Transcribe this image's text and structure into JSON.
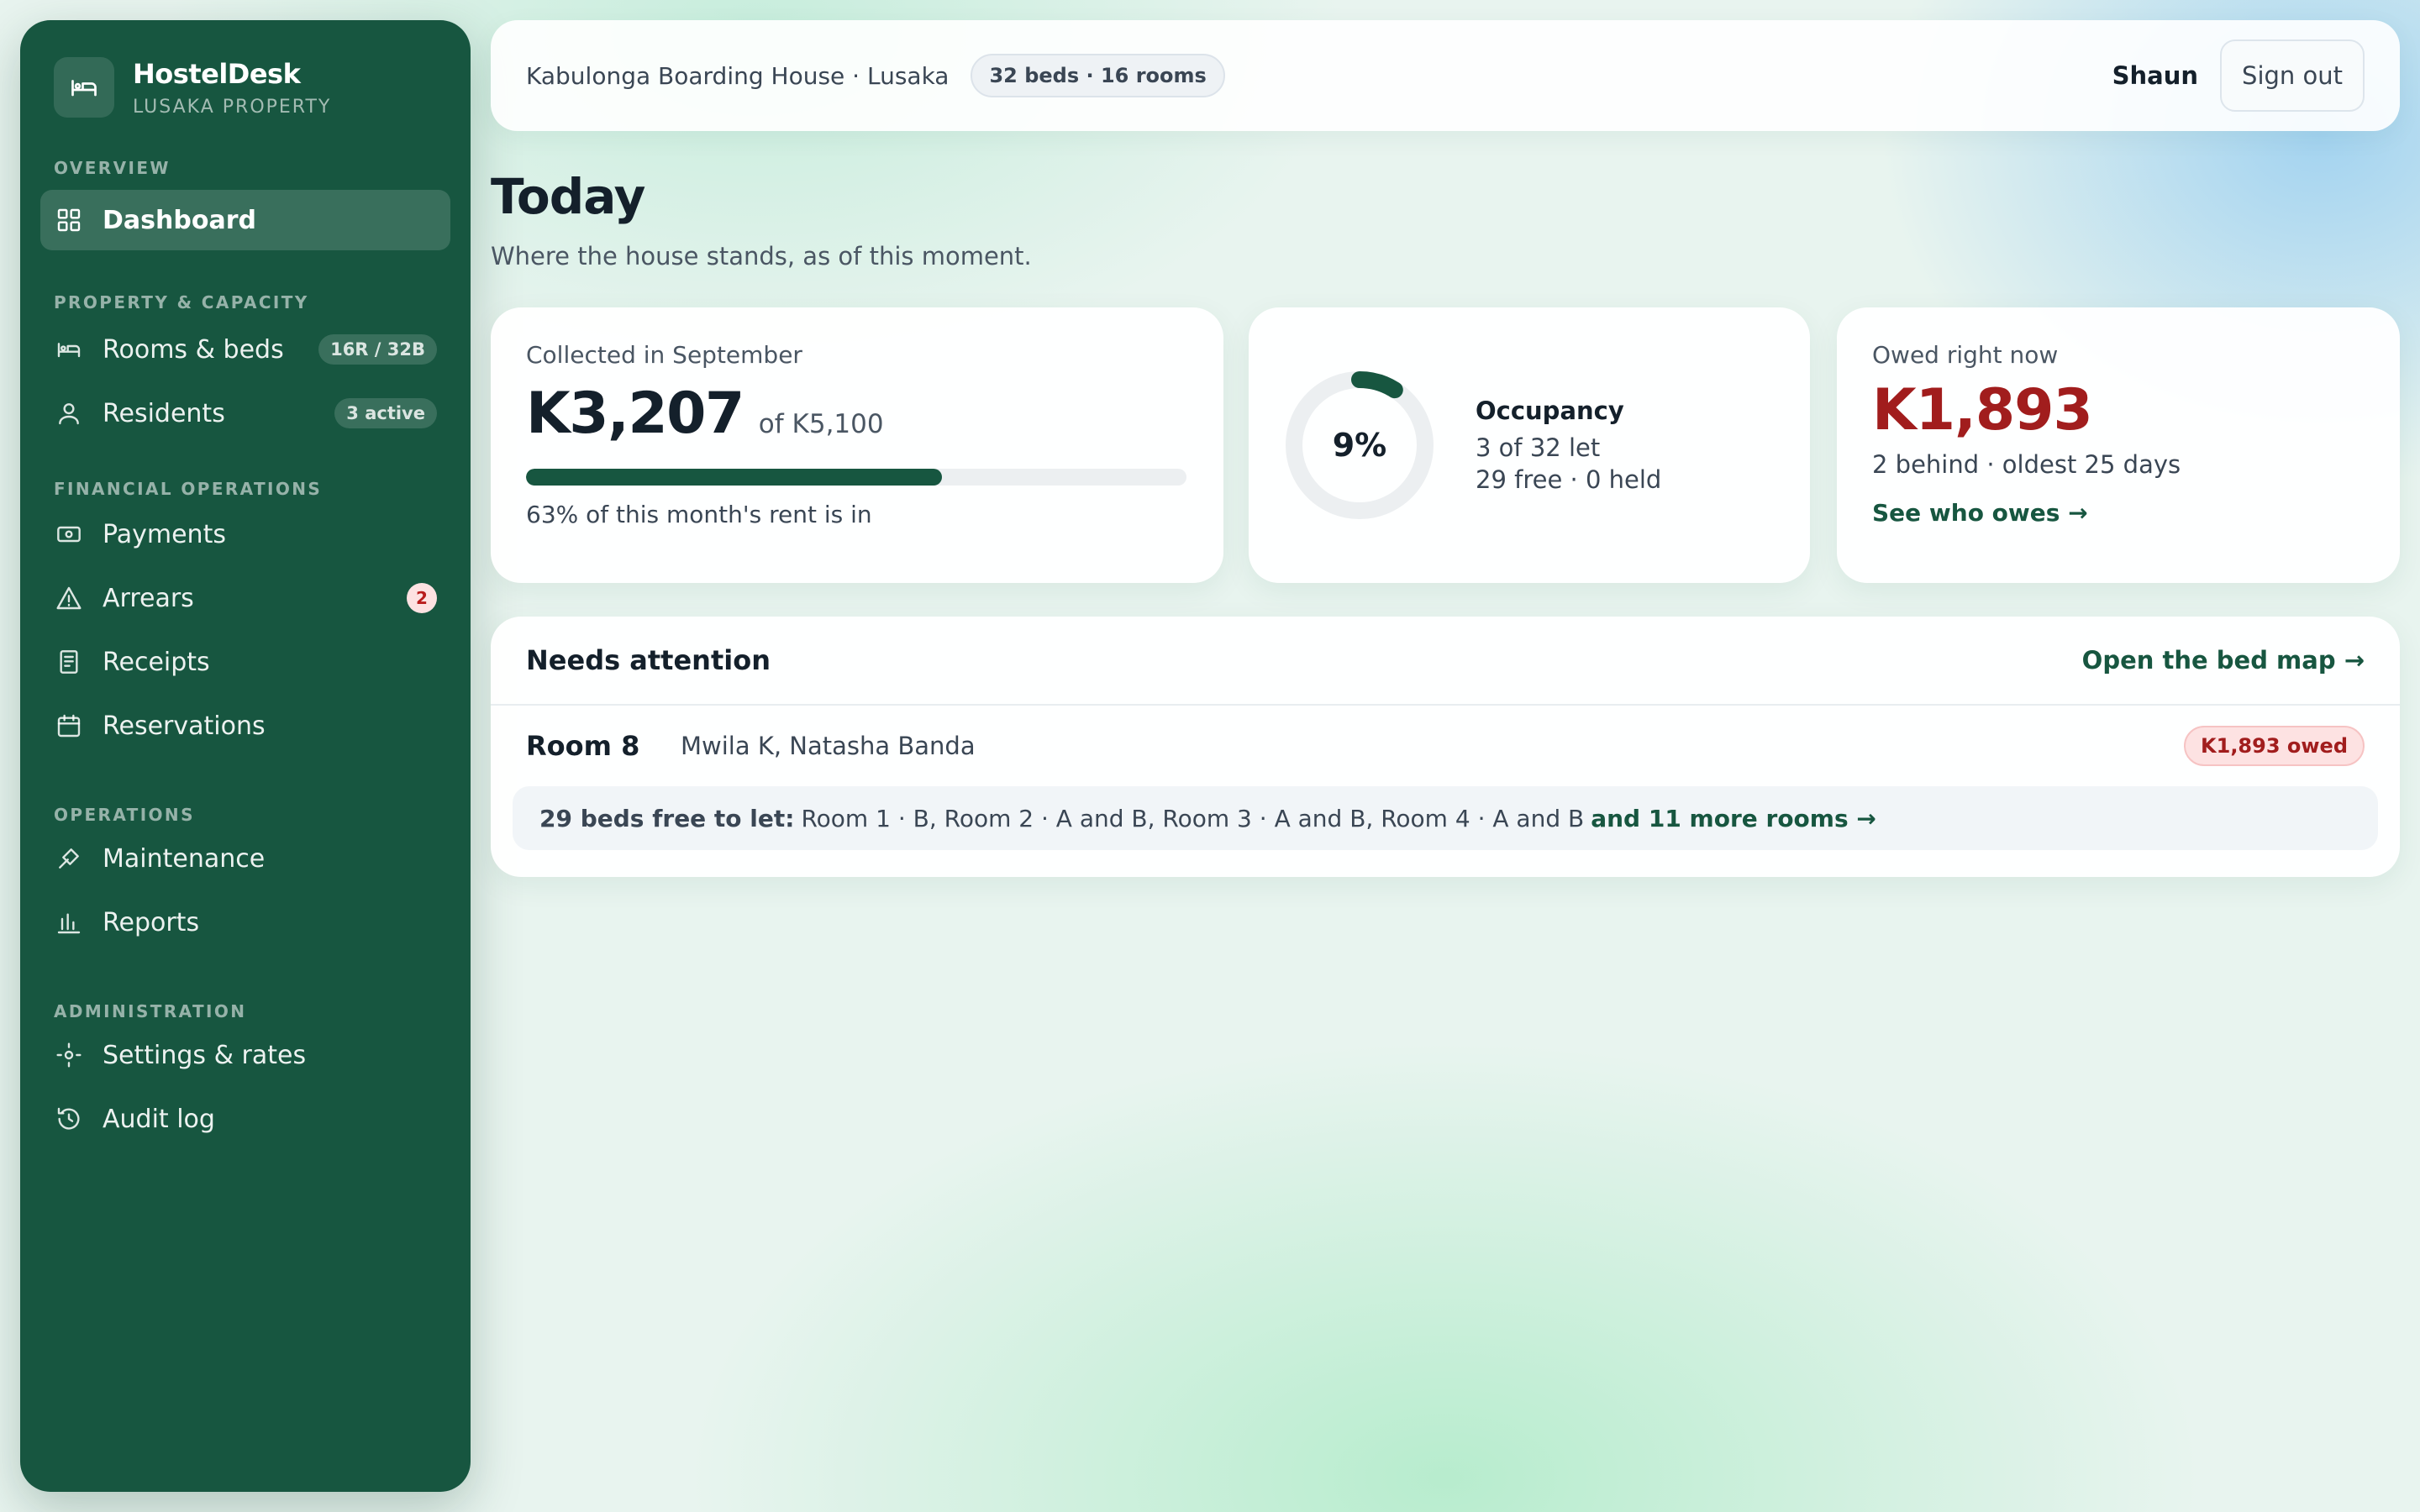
{
  "brand": {
    "name": "HostelDesk",
    "sub": "LUSAKA PROPERTY",
    "icon": "bed-icon"
  },
  "nav": {
    "overview": {
      "title": "OVERVIEW",
      "items": [
        {
          "label": "Dashboard",
          "icon": "grid-icon",
          "active": true
        }
      ]
    },
    "property": {
      "title": "PROPERTY & CAPACITY",
      "items": [
        {
          "label": "Rooms & beds",
          "icon": "bed-icon",
          "pill": "16R / 32B"
        },
        {
          "label": "Residents",
          "icon": "user-icon",
          "pill": "3 active"
        }
      ]
    },
    "financial": {
      "title": "FINANCIAL OPERATIONS",
      "items": [
        {
          "label": "Payments",
          "icon": "cash-icon"
        },
        {
          "label": "Arrears",
          "icon": "warning-icon",
          "badge": "2"
        },
        {
          "label": "Receipts",
          "icon": "receipt-icon"
        },
        {
          "label": "Reservations",
          "icon": "calendar-icon"
        }
      ]
    },
    "operations": {
      "title": "OPERATIONS",
      "items": [
        {
          "label": "Maintenance",
          "icon": "wrench-icon"
        },
        {
          "label": "Reports",
          "icon": "bar-chart-icon"
        }
      ]
    },
    "admin": {
      "title": "ADMINISTRATION",
      "items": [
        {
          "label": "Settings & rates",
          "icon": "settings-icon"
        },
        {
          "label": "Audit log",
          "icon": "history-icon"
        }
      ]
    }
  },
  "topbar": {
    "property": "Kabulonga Boarding House · Lusaka",
    "capacity": "32 beds · 16 rooms",
    "user": "Shaun",
    "signout": "Sign out"
  },
  "page": {
    "title": "Today",
    "subtitle": "Where the house stands, as of this moment."
  },
  "collected": {
    "label": "Collected in September",
    "amount": "K3,207",
    "of": "of K5,100",
    "progress": 0.63,
    "note": "63% of this month's rent is in"
  },
  "occupancy": {
    "percent_label": "9%",
    "fraction": 0.09,
    "title": "Occupancy",
    "line1": "3 of 32 let",
    "line2": "29 free · 0 held"
  },
  "owed": {
    "label": "Owed right now",
    "amount": "K1,893",
    "sub": "2 behind · oldest 25 days",
    "link": "See who owes →"
  },
  "attention": {
    "title": "Needs attention",
    "link": "Open the bed map →",
    "row": {
      "room": "Room 8",
      "names": "Mwila K, Natasha Banda",
      "badge": "K1,893 owed"
    },
    "free": {
      "lead": "29 beds free to let:",
      "list": "Room 1 · B, Room 2 · A and B, Room 3 · A and B, Room 4 · A and B",
      "more": "and 11 more rooms →"
    }
  },
  "colors": {
    "brand": "#175640",
    "danger": "#a11d1d",
    "accent_bg": "#e8f4ef"
  }
}
